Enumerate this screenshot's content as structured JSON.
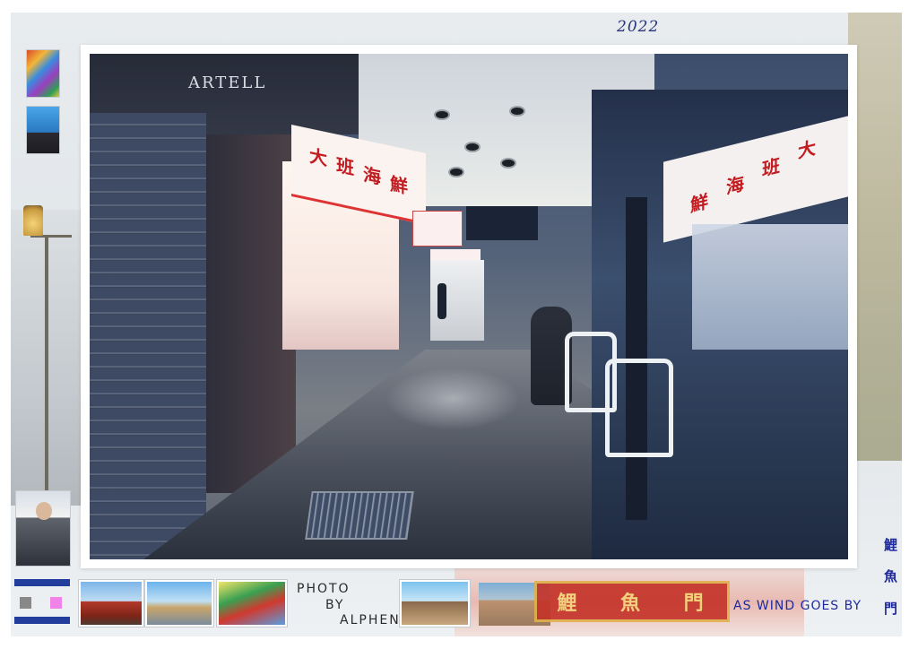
{
  "header": {
    "year": "2022"
  },
  "photo": {
    "shop_sign_left": [
      "大",
      "班",
      "海",
      "鮮"
    ],
    "awning_text": "ARTELL",
    "shop_sign_right": [
      "大",
      "班",
      "海",
      "鮮"
    ]
  },
  "credit": {
    "photo": "PHOTO",
    "by": "BY",
    "author": "ALPHEN"
  },
  "temple_sign": [
    "鯉",
    "魚",
    "門"
  ],
  "motto": "AS WIND GOES BY",
  "vertical_text": [
    "鯉",
    "魚",
    "門"
  ],
  "thumbnails": [
    "gate",
    "city-waterfront",
    "tram",
    "beach-rock"
  ],
  "colors": {
    "accent_blue": "#1f2a9e",
    "flag_blue": "#233d9c",
    "flag_grey": "#888888",
    "flag_pink": "#f082e8"
  }
}
